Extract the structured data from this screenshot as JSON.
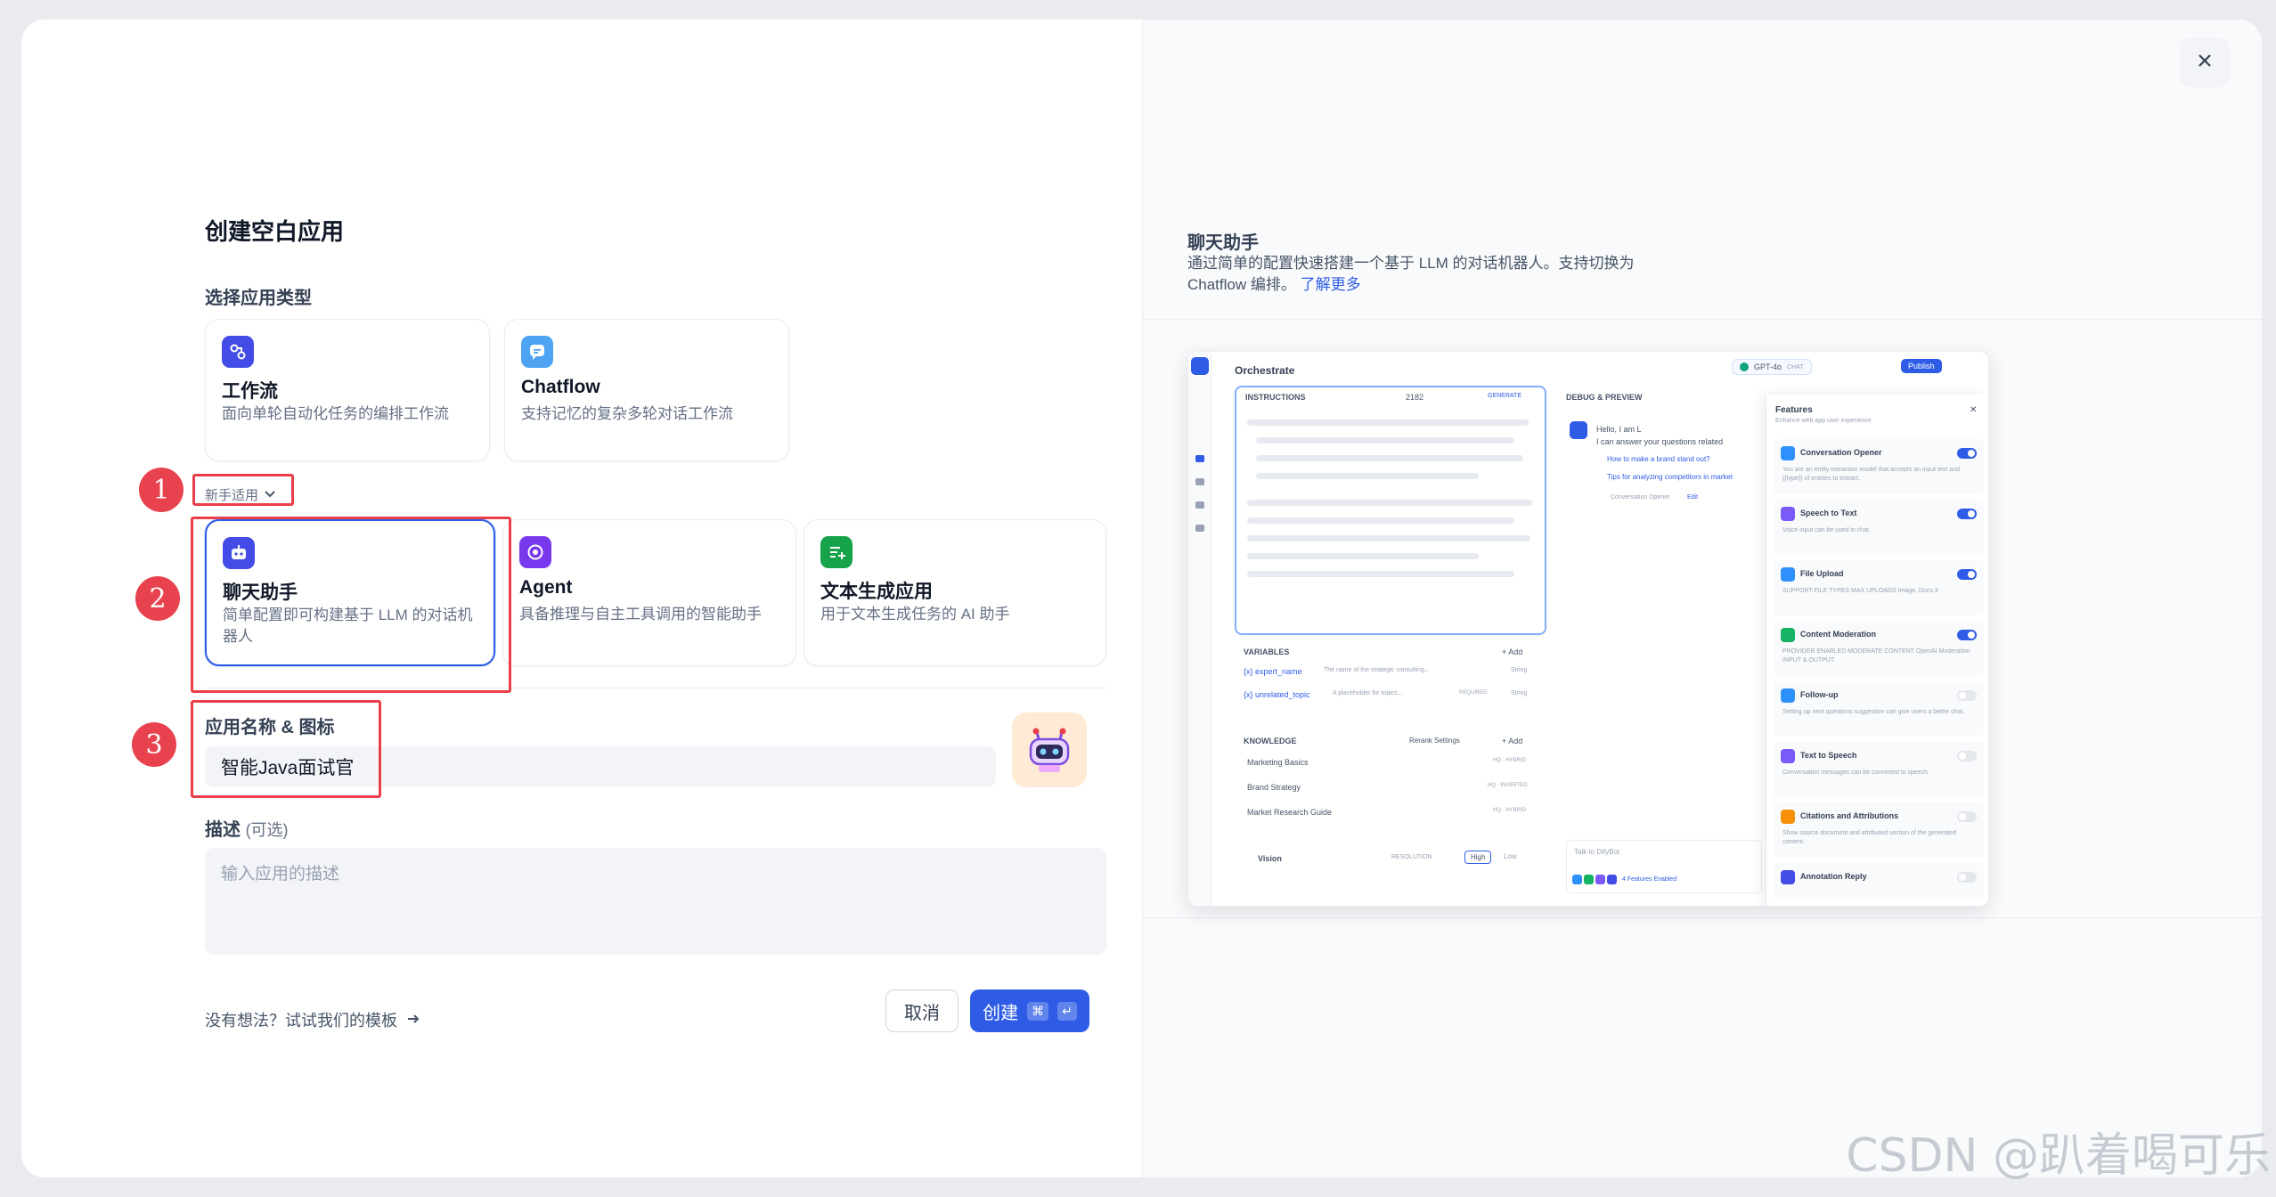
{
  "header": {
    "title": "创建空白应用"
  },
  "app_type": {
    "label": "选择应用类型",
    "primary_cards": [
      {
        "title": "工作流",
        "desc": "面向单轮自动化任务的编排工作流",
        "icon": "workflow-icon",
        "color": "#444ce7"
      },
      {
        "title": "Chatflow",
        "desc": "支持记忆的复杂多轮对话工作流",
        "icon": "chatflow-icon",
        "color": "#4ea4f2"
      }
    ],
    "beginner_toggle": "新手适用",
    "beginner_cards": [
      {
        "title": "聊天助手",
        "desc": "简单配置即可构建基于 LLM 的对话机器人",
        "icon": "chat-bot-icon",
        "color": "#444ce7"
      },
      {
        "title": "Agent",
        "desc": "具备推理与自主工具调用的智能助手",
        "icon": "agent-icon",
        "color": "#7839ee"
      },
      {
        "title": "文本生成应用",
        "desc": "用于文本生成任务的 AI 助手",
        "icon": "text-gen-icon",
        "color": "#16a34a"
      }
    ]
  },
  "annotations": [
    "1",
    "2",
    "3"
  ],
  "app_name": {
    "label": "应用名称 & 图标",
    "value": "智能Java面试官",
    "icon": "robot-avatar-icon"
  },
  "description": {
    "label": "描述",
    "optional": "(可选)",
    "placeholder": "输入应用的描述"
  },
  "footer": {
    "template_link": "没有想法？试试我们的模板",
    "cancel": "取消",
    "create": "创建",
    "shortcut_cmd": "⌘",
    "shortcut_enter": "↵"
  },
  "preview": {
    "title": "聊天助手",
    "desc": "通过简单的配置快速搭建一个基于 LLM 的对话机器人。支持切换为 Chatflow 编排。",
    "learn_more": "了解更多",
    "mock": {
      "orchestrate": "Orchestrate",
      "model": "GPT-4o",
      "chat_tag": "CHAT",
      "publish": "Publish",
      "instructions": "INSTRUCTIONS",
      "count": "2182",
      "generate": "GENERATE",
      "debug": "DEBUG & PREVIEW",
      "hello": "Hello, I am L",
      "hello2": "I can answer your questions related",
      "q1": "How to make a brand stand out?",
      "q2": "Tips for analyzing competitors in market",
      "opener": "Conversation Opener",
      "edit": "Edit",
      "variables": "VARIABLES",
      "add": "+ Add",
      "var1": "{x} expert_name",
      "var1d": "The name of the strategic consulting...",
      "var1t": "String",
      "var2": "{x} unrelated_topic",
      "var2d": "A placeholder for topics...",
      "var2r": "REQUIRED",
      "var2t": "String",
      "knowledge": "KNOWLEDGE",
      "rerank": "Rerank Settings",
      "k1": "Marketing Basics",
      "k1t": "HQ · HYBRID",
      "k2": "Brand Strategy",
      "k2t": "HQ · INVERTED",
      "k3": "Market Research Guide",
      "k3t": "HQ · HYBRID",
      "vision": "Vision",
      "resolution": "RESOLUTION",
      "high": "High",
      "low": "Low",
      "talk": "Talk to DifyBot",
      "enabled": "4 Features Enabled",
      "features": "Features",
      "features_sub": "Enhance web app user experience",
      "f": [
        {
          "name": "Conversation Opener",
          "desc": "You are an entity extraction model that accepts an input text and {{type}} of entities to extract.",
          "color": "#2e90fa",
          "on": true
        },
        {
          "name": "Speech to Text",
          "desc": "Voice input can be used in chat.",
          "color": "#7a5af8",
          "on": true
        },
        {
          "name": "File Upload",
          "desc": "SUPPORT FILE TYPES  MAX UPLOADS  Image, Docs  3",
          "color": "#2e90fa",
          "on": true
        },
        {
          "name": "Content Moderation",
          "desc": "PROVIDER  ENABLED MODERATE CONTENT  OpenAI Moderation  INPUT & OUTPUT",
          "color": "#16b364",
          "on": true
        },
        {
          "name": "Follow-up",
          "desc": "Setting up next questions suggestion can give users a better chat.",
          "color": "#2e90fa",
          "on": false
        },
        {
          "name": "Text to Speech",
          "desc": "Conversation messages can be converted to speech.",
          "color": "#7a5af8",
          "on": false
        },
        {
          "name": "Citations and Attributions",
          "desc": "Show source document and attributed section of the generated content.",
          "color": "#f79009",
          "on": false
        },
        {
          "name": "Annotation Reply",
          "desc": "",
          "color": "#444ce7",
          "on": false
        }
      ]
    }
  },
  "watermark": "CSDN @趴着喝可乐"
}
